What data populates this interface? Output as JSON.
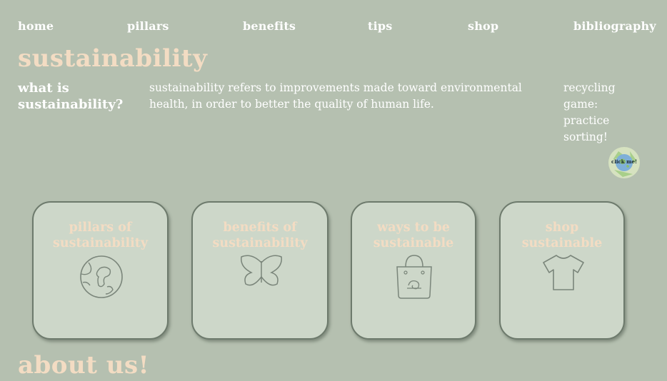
{
  "nav": {
    "home": "home",
    "pillars": "pillars",
    "benefits": "benefits",
    "tips": "tips",
    "shop": "shop",
    "bibliography": "bibliography"
  },
  "header": {
    "title": "sustainability"
  },
  "intro": {
    "question": "what is sustainability?",
    "definition": "sustainability refers to improvements made toward environmental health, in order to better the quality of human life."
  },
  "game": {
    "text": "recycling game: practice sorting!",
    "button_label": "click me!",
    "icon": "recycle-globe-icon"
  },
  "cards": [
    {
      "label": "pillars of sustainability",
      "icon": "earth-icon"
    },
    {
      "label": "benefits of sustainability",
      "icon": "butterfly-icon"
    },
    {
      "label": "ways to be sustainable",
      "icon": "tote-bag-icon"
    },
    {
      "label": "shop sustainable",
      "icon": "tshirt-icon"
    }
  ],
  "about": {
    "title": "about us!"
  },
  "colors": {
    "background": "#b5c0b0",
    "card": "#cdd7c9",
    "accent": "#f3dcc3",
    "text": "#ffffff"
  }
}
